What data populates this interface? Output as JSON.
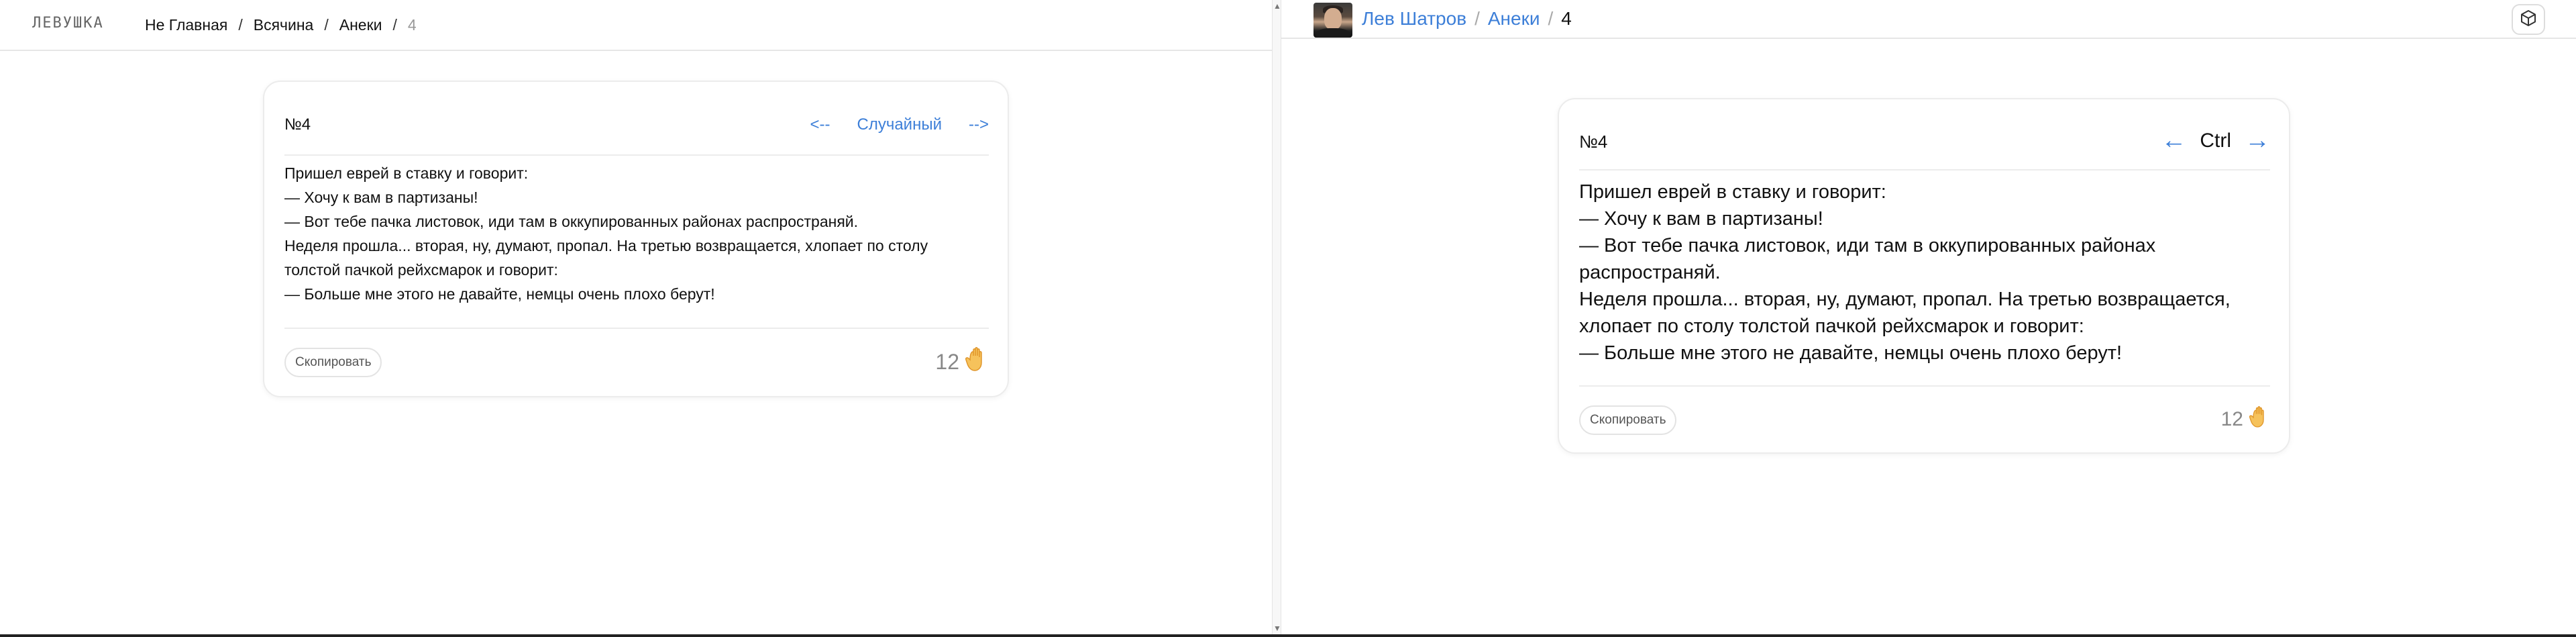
{
  "left": {
    "logo": "ЛЕВУШКА",
    "breadcrumbs": {
      "home": "Не Главная",
      "section": "Всячина",
      "subsection": "Анеки",
      "current": "4",
      "separator": "/"
    },
    "card": {
      "number": "№4",
      "prev": "<--",
      "random": "Случайный",
      "next": "-->",
      "lines": [
        "Пришел еврей в ставку и говорит:",
        "— Хочу к вам в партизаны!",
        "— Вот тебе пачка листовок, иди там в оккупированных районах распространяй.",
        "Неделя прошла... вторая, ну, думают, пропал. На третью возвращается, хлопает по столу",
        "толстой пачкой рейхсмарок и говорит:",
        "— Больше мне этого не давайте, немцы очень плохо берут!"
      ],
      "copy_label": "Скопировать",
      "likes": "12",
      "like_icon": "waving-hand-icon"
    }
  },
  "right": {
    "breadcrumbs": {
      "author": "Лев Шатров",
      "section": "Анеки",
      "current": "4",
      "separator": "/"
    },
    "cube_icon": "cube-icon",
    "card": {
      "number": "№4",
      "prev": "←",
      "ctrl": "Ctrl",
      "next": "→",
      "lines": [
        "Пришел еврей в ставку и говорит:",
        "— Хочу к вам в партизаны!",
        "— Вот тебе пачка листовок, иди там в оккупированных районах",
        "распространяй.",
        "Неделя прошла... вторая, ну, думают, пропал. На третью возвращается,",
        "хлопает по столу толстой пачкой рейхсмарок и говорит:",
        "— Больше мне этого не давайте, немцы очень плохо берут!"
      ],
      "copy_label": "Скопировать",
      "likes": "12",
      "like_icon": "waving-hand-icon"
    }
  },
  "colors": {
    "link": "#3d7fd8",
    "border": "#ececec",
    "muted": "#888888"
  }
}
